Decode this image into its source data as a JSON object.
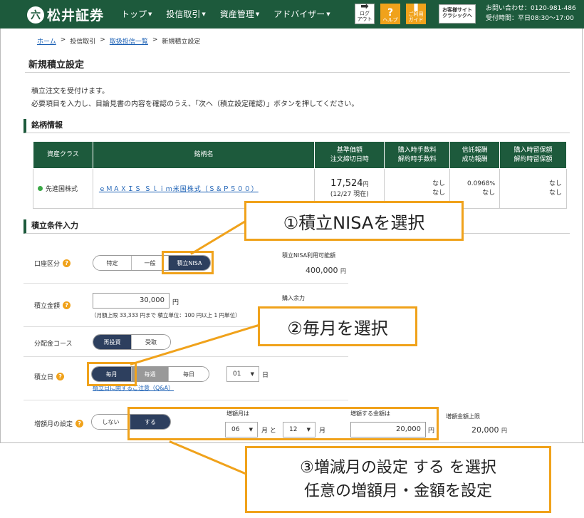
{
  "header": {
    "logo_mark": "六",
    "logo_text": "松井証券",
    "nav": [
      "トップ",
      "投信取引",
      "資産管理",
      "アドバイザー"
    ],
    "logout": [
      "ログ",
      "アウト"
    ],
    "help": "ヘルプ",
    "guide": [
      "ご利用",
      "ガイド"
    ],
    "classic": [
      "お客様サイト",
      "クラシックへ"
    ],
    "contact_phone": "お問い合わせ：0120-981-486",
    "contact_hours": "受付時間：平日08:30～17:00"
  },
  "breadcrumb": [
    "ホーム",
    ">",
    "投信取引",
    ">",
    "取扱投信一覧",
    ">",
    "新規積立設定"
  ],
  "page_title": "新規積立設定",
  "intro": [
    "積立注文を受付けます。",
    "必要項目を入力し、目論見書の内容を確認のうえ、「次へ（積立設定確認）」ボタンを押してください。"
  ],
  "fund_section": "銘柄情報",
  "fund_table": {
    "headers": [
      "資産クラス",
      "銘柄名",
      [
        "基準価額",
        "注文締切日時"
      ],
      [
        "購入時手数料",
        "解約時手数料"
      ],
      [
        "信託報酬",
        "成功報酬"
      ],
      [
        "購入時留保額",
        "解約時留保額"
      ]
    ],
    "asset_class": "先進国株式",
    "fund_name": "ｅＭＡＸＩＳ Ｓｌｉｍ米国株式（Ｓ＆Ｐ５００）",
    "price": "17,524",
    "price_unit": "円",
    "price_date": "(12/27 現在)",
    "fee_buy": "なし",
    "fee_sell": "なし",
    "trust_fee": "0.0968",
    "trust_unit": "%",
    "success_fee": "なし",
    "reserve_buy": "なし",
    "reserve_sell": "なし"
  },
  "cond_section": "積立条件入力",
  "account": {
    "label": "口座区分",
    "options": [
      "特定",
      "一般",
      "積立NISA"
    ],
    "avail_label": "積立NISA利用可能額",
    "avail_value": "400,000",
    "avail_unit": "円"
  },
  "amount": {
    "label": "積立金額",
    "value": "30,000",
    "unit": "円",
    "note": "（月額上限 33,333 円まで  積立単位：100 円以上 1 円単位）",
    "power_label": "購入余力"
  },
  "dividend": {
    "label": "分配金コース",
    "options": [
      "再投資",
      "受取"
    ]
  },
  "day": {
    "label": "積立日",
    "options": [
      "毎月",
      "毎週",
      "毎日"
    ],
    "value": "01",
    "unit": "日",
    "link": "積立日に関するご注意（Q&A）"
  },
  "increase": {
    "label": "増額月の設定",
    "options": [
      "しない",
      "する"
    ],
    "months_label": "増額月は",
    "month1": "06",
    "month_and": "月 と",
    "month2": "12",
    "month_unit": "月",
    "amount_label": "増額する金額は",
    "amount_value": "20,000",
    "amount_unit": "円",
    "limit_label": "増額金額上限",
    "limit_value": "20,000",
    "limit_unit": "円"
  },
  "callouts": {
    "c1": "①積立NISAを選択",
    "c2": "②毎月を選択",
    "c3_line1": "③増減月の設定 する を選択",
    "c3_line2": "任意の増額月・金額を設定"
  },
  "colors": {
    "brand_green": "#1d5a3c",
    "accent_orange": "#f0a21b",
    "active_navy": "#2d3f5e"
  }
}
